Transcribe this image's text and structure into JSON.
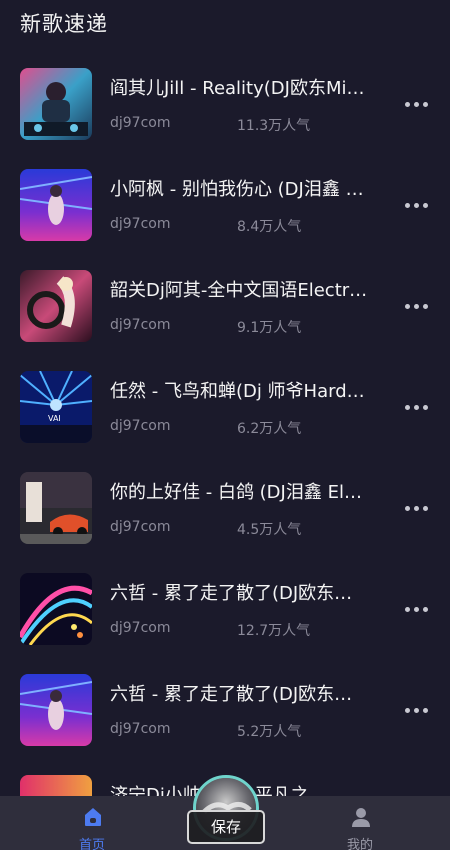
{
  "header": {
    "title": "新歌速递"
  },
  "songs": [
    {
      "title": "阎其儿Jill - Reality(DJ欧东Mi…",
      "site": "dj97com",
      "plays": "11.3万人气"
    },
    {
      "title": "小阿枫 - 别怕我伤心 (DJ泪鑫 …",
      "site": "dj97com",
      "plays": "8.4万人气"
    },
    {
      "title": "韶关Dj阿其-全中文国语Electr…",
      "site": "dj97com",
      "plays": "9.1万人气"
    },
    {
      "title": "任然 - 飞鸟和蝉(Dj 师爷Hard…",
      "site": "dj97com",
      "plays": "6.2万人气"
    },
    {
      "title": "你的上好佳 - 白鸽 (DJ泪鑫 El…",
      "site": "dj97com",
      "plays": "4.5万人气"
    },
    {
      "title": "六哲 - 累了走了散了(DJ欧东…",
      "site": "dj97com",
      "plays": "12.7万人气"
    },
    {
      "title": "六哲 - 累了走了散了(DJ欧东…",
      "site": "dj97com",
      "plays": "5.2万人气"
    },
    {
      "title": "济宁Dj小帅 - 鼓之平凡之",
      "site": "",
      "plays": ""
    }
  ],
  "tabbar": {
    "home_label": "首页",
    "me_label": "我的",
    "save_label": "保存"
  },
  "icons": {
    "more": "more-dots-icon",
    "home": "home-icon",
    "me": "person-icon"
  },
  "colors": {
    "background": "#1b1a2b",
    "tabbar": "#2f2e3c",
    "accent": "#4d7bf0"
  }
}
